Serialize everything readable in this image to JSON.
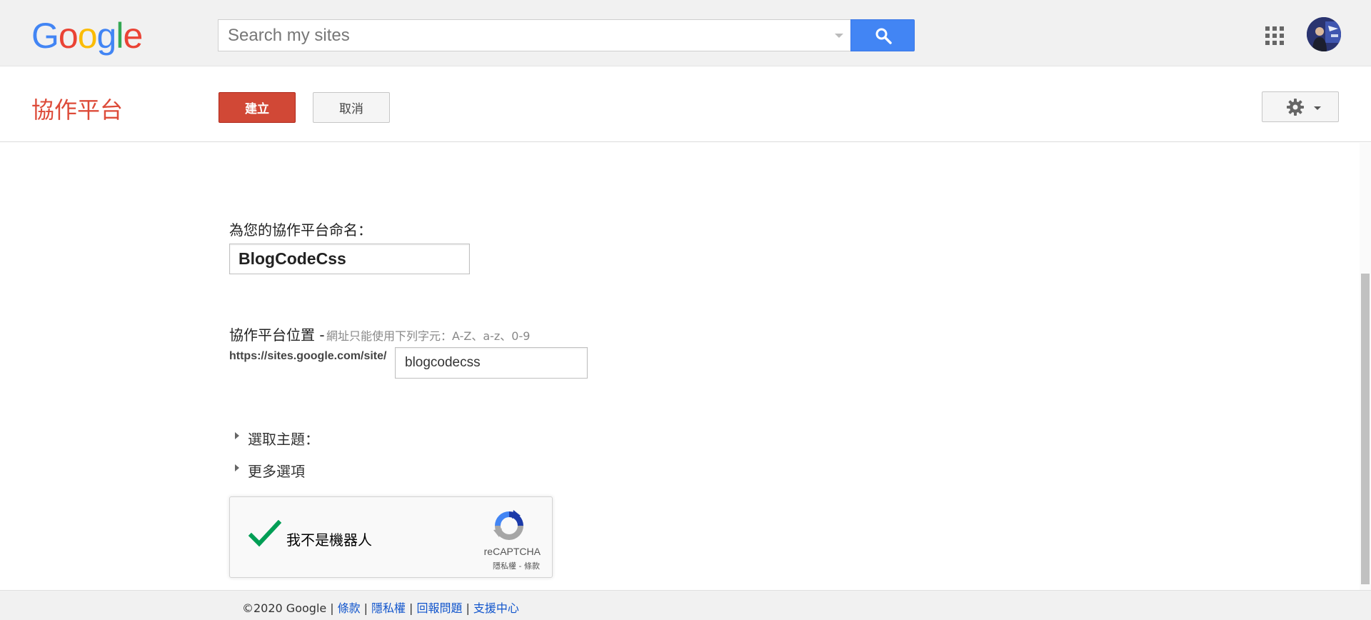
{
  "header": {
    "logo_letters": [
      "G",
      "o",
      "o",
      "g",
      "l",
      "e"
    ],
    "logo_colors": [
      "#4285f4",
      "#ea4335",
      "#fbbc05",
      "#4285f4",
      "#34a853",
      "#ea4335"
    ],
    "search_placeholder": "Search my sites",
    "search_icon": "search-icon",
    "apps_icon": "apps-grid-icon",
    "avatar_icon": "user-avatar"
  },
  "actionbar": {
    "product_title": "協作平台",
    "create_label": "建立",
    "cancel_label": "取消",
    "settings_icon": "gear-icon",
    "accent_color": "#d14836"
  },
  "form": {
    "name_label": "為您的協作平台命名：",
    "site_name_value": "BlogCodeCss",
    "location_label": "協作平台位置 -",
    "location_hint": "網址只能使用下列字元：A-Z、a-z、0-9",
    "url_prefix": "https://sites.google.com/site/",
    "site_url_value": "blogcodecss",
    "theme_label": "選取主題：",
    "more_options_label": "更多選項"
  },
  "recaptcha": {
    "label": "我不是機器人",
    "brand": "reCAPTCHA",
    "links": "隱私權 - 條款",
    "checked": true
  },
  "footer": {
    "copyright": "©2020 Google",
    "links": [
      "條款",
      "隱私權",
      "回報問題",
      "支援中心"
    ]
  }
}
